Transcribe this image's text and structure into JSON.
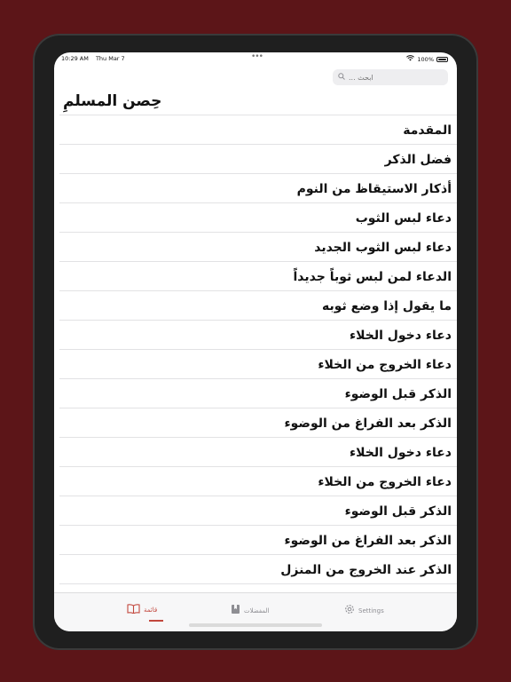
{
  "status_bar": {
    "time": "10:29 AM",
    "date": "Thu Mar 7",
    "dots": "•••",
    "battery": "100%",
    "wifi_icon": "wifi-icon",
    "battery_icon": "battery-icon"
  },
  "search": {
    "placeholder": "ابحث ..."
  },
  "header": {
    "title": "حِصن المسلمِ"
  },
  "list": {
    "items": [
      "المقدمة",
      "فضل الذكر",
      "أذكار الاستيقاظ من النوم",
      "دعاء لبس الثوب",
      "دعاء لبس الثوب الجديد",
      "الدعاء لمن لبس ثوباً جديداً",
      "ما يقول إذا وضع ثوبه",
      "دعاء دخول الخلاء",
      "دعاء الخروج من الخلاء",
      "الذكر قبل الوضوء",
      "الذكر بعد الفراغ من الوضوء",
      "دعاء دخول الخلاء",
      "دعاء الخروج من الخلاء",
      "الذكر قبل الوضوء",
      "الذكر بعد الفراغ من الوضوء",
      "الذكر عند الخروج من المنزل"
    ]
  },
  "tab_bar": {
    "list_label": "قائمة",
    "favorites_label": "المفضلات",
    "settings_label": "Settings",
    "active_color": "#c2473d"
  }
}
